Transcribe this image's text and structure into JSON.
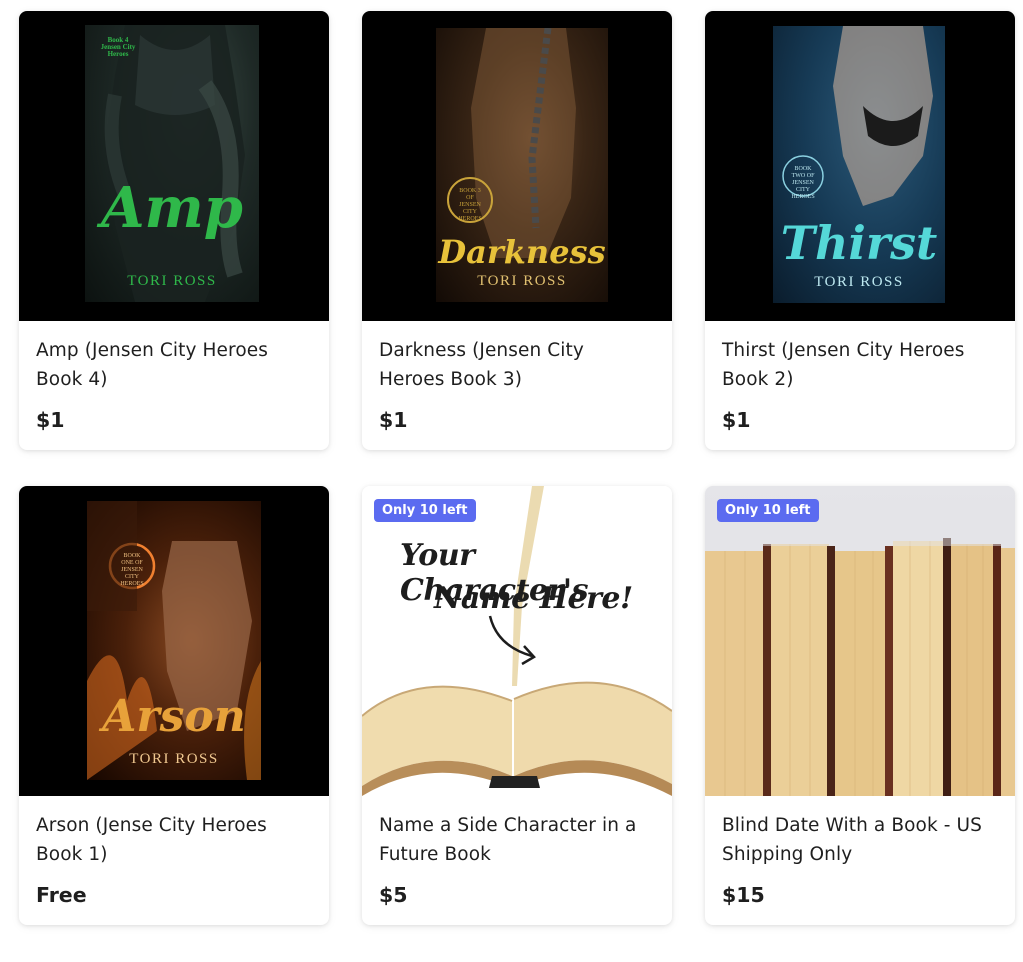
{
  "products": [
    {
      "title": "Amp (Jensen City Heroes Book 4)",
      "price": "$1",
      "cover_title": "Amp",
      "cover_author": "TORI ROSS",
      "cover_series": "Book 4 Jensen City Heroes",
      "cover_color": "#2fb84a"
    },
    {
      "title": "Darkness (Jensen City Heroes Book 3)",
      "price": "$1",
      "cover_title": "Darkness",
      "cover_author": "TORI ROSS",
      "cover_series": "BOOK 3 OF JENSEN CITY HEROES",
      "cover_color": "#e8c23a"
    },
    {
      "title": "Thirst (Jensen City Heroes Book 2)",
      "price": "$1",
      "cover_title": "Thirst",
      "cover_author": "TORI ROSS",
      "cover_series": "BOOK TWO OF JENSEN CITY HEROES",
      "cover_color": "#55d8d8"
    },
    {
      "title": "Arson (Jense City Heroes Book 1)",
      "price": "Free",
      "cover_title": "Arson",
      "cover_author": "TORI ROSS",
      "cover_series": "BOOK ONE OF JENSEN CITY HEROES",
      "cover_color": "#e8a23a"
    },
    {
      "title": "Name a Side Character in a Future Book",
      "price": "$5",
      "badge": "Only 10 left",
      "image_text_line1": "Your Character's",
      "image_text_line2": "Name Here!"
    },
    {
      "title": "Blind Date With a Book - US Shipping Only",
      "price": "$15",
      "badge": "Only 10 left"
    }
  ],
  "colors": {
    "badge": "#5b6bf0",
    "text": "#1f1f1f"
  }
}
